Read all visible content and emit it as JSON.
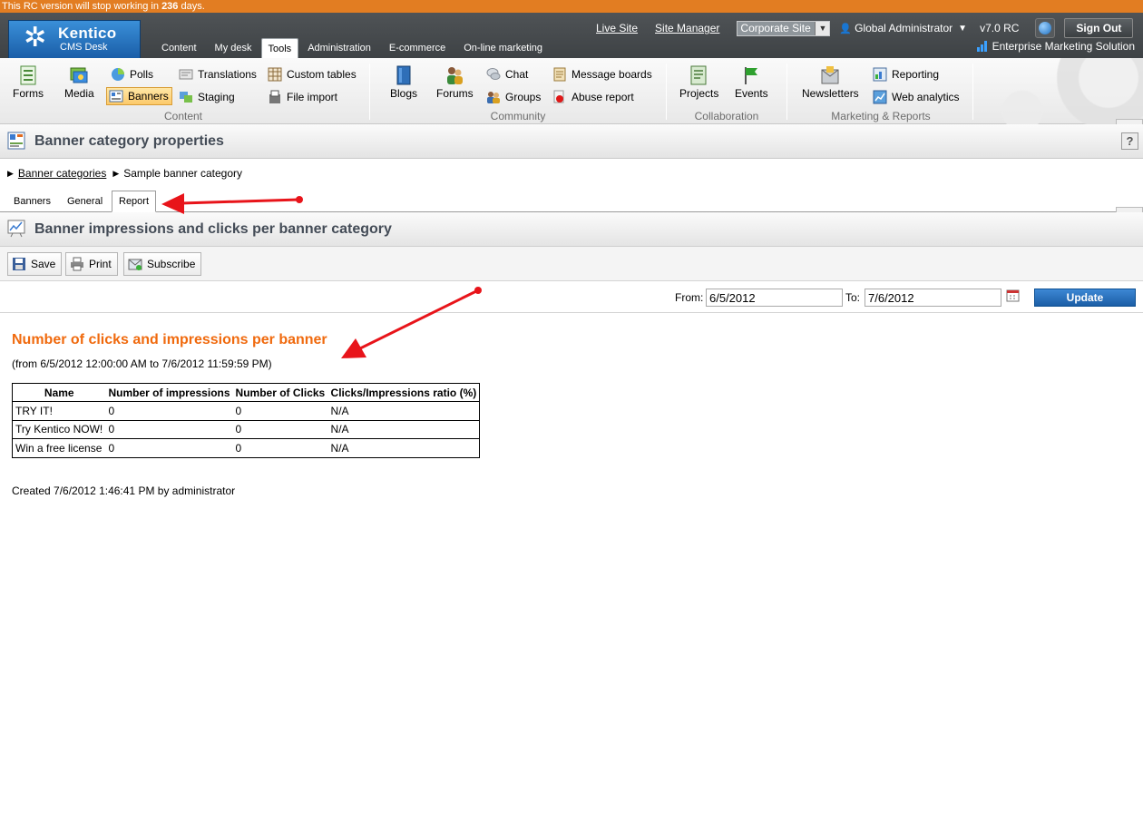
{
  "rc_notice": {
    "prefix": "This RC version will stop working in ",
    "days": "236",
    "suffix": " days."
  },
  "header": {
    "logo_name": "Kentico",
    "logo_sub": "CMS Desk",
    "tabs": [
      "Content",
      "My desk",
      "Tools",
      "Administration",
      "E-commerce",
      "On-line marketing"
    ],
    "active_tab": "Tools",
    "live_site": "Live Site",
    "site_manager": "Site Manager",
    "site_select": "Corporate Site",
    "user": "Global Administrator",
    "version": "v7.0 RC",
    "sign_out": "Sign Out",
    "edition": "Enterprise Marketing Solution"
  },
  "ribbon": {
    "content": {
      "label": "Content",
      "forms": "Forms",
      "media": "Media",
      "polls": "Polls",
      "banners": "Banners",
      "translations": "Translations",
      "staging": "Staging",
      "custom_tables": "Custom tables",
      "file_import": "File import"
    },
    "community": {
      "label": "Community",
      "blogs": "Blogs",
      "forums": "Forums",
      "chat": "Chat",
      "groups": "Groups",
      "message_boards": "Message boards",
      "abuse_report": "Abuse report"
    },
    "collaboration": {
      "label": "Collaboration",
      "projects": "Projects",
      "events": "Events"
    },
    "marketing": {
      "label": "Marketing & Reports",
      "newsletters": "Newsletters",
      "reporting": "Reporting",
      "web_analytics": "Web analytics"
    }
  },
  "page": {
    "title": "Banner category properties",
    "breadcrumb_link": "Banner categories",
    "breadcrumb_current": "Sample banner category",
    "tabs": [
      "Banners",
      "General",
      "Report"
    ],
    "active_tab": "Report"
  },
  "report": {
    "bar_title": "Banner impressions and clicks per banner category",
    "toolbar": {
      "save": "Save",
      "print": "Print",
      "subscribe": "Subscribe"
    },
    "from_label": "From:",
    "from_value": "6/5/2012",
    "to_label": "To:",
    "to_value": "7/6/2012",
    "update": "Update",
    "heading": "Number of clicks and impressions per banner",
    "range": "(from 6/5/2012 12:00:00 AM to 7/6/2012 11:59:59 PM)",
    "columns": [
      "Name",
      "Number of impressions",
      "Number of Clicks",
      "Clicks/Impressions ratio (%)"
    ],
    "rows": [
      [
        "TRY IT!",
        "0",
        "0",
        "N/A"
      ],
      [
        "Try Kentico NOW!",
        "0",
        "0",
        "N/A"
      ],
      [
        "Win a free license",
        "0",
        "0",
        "N/A"
      ]
    ],
    "created": "Created 7/6/2012 1:46:41 PM by administrator"
  },
  "colors": {
    "rc_bar": "#e27d22",
    "header": "#4a4e51",
    "heading": "#f06a0e",
    "update": "#1b5ea6",
    "annotation": "#e8141a"
  }
}
